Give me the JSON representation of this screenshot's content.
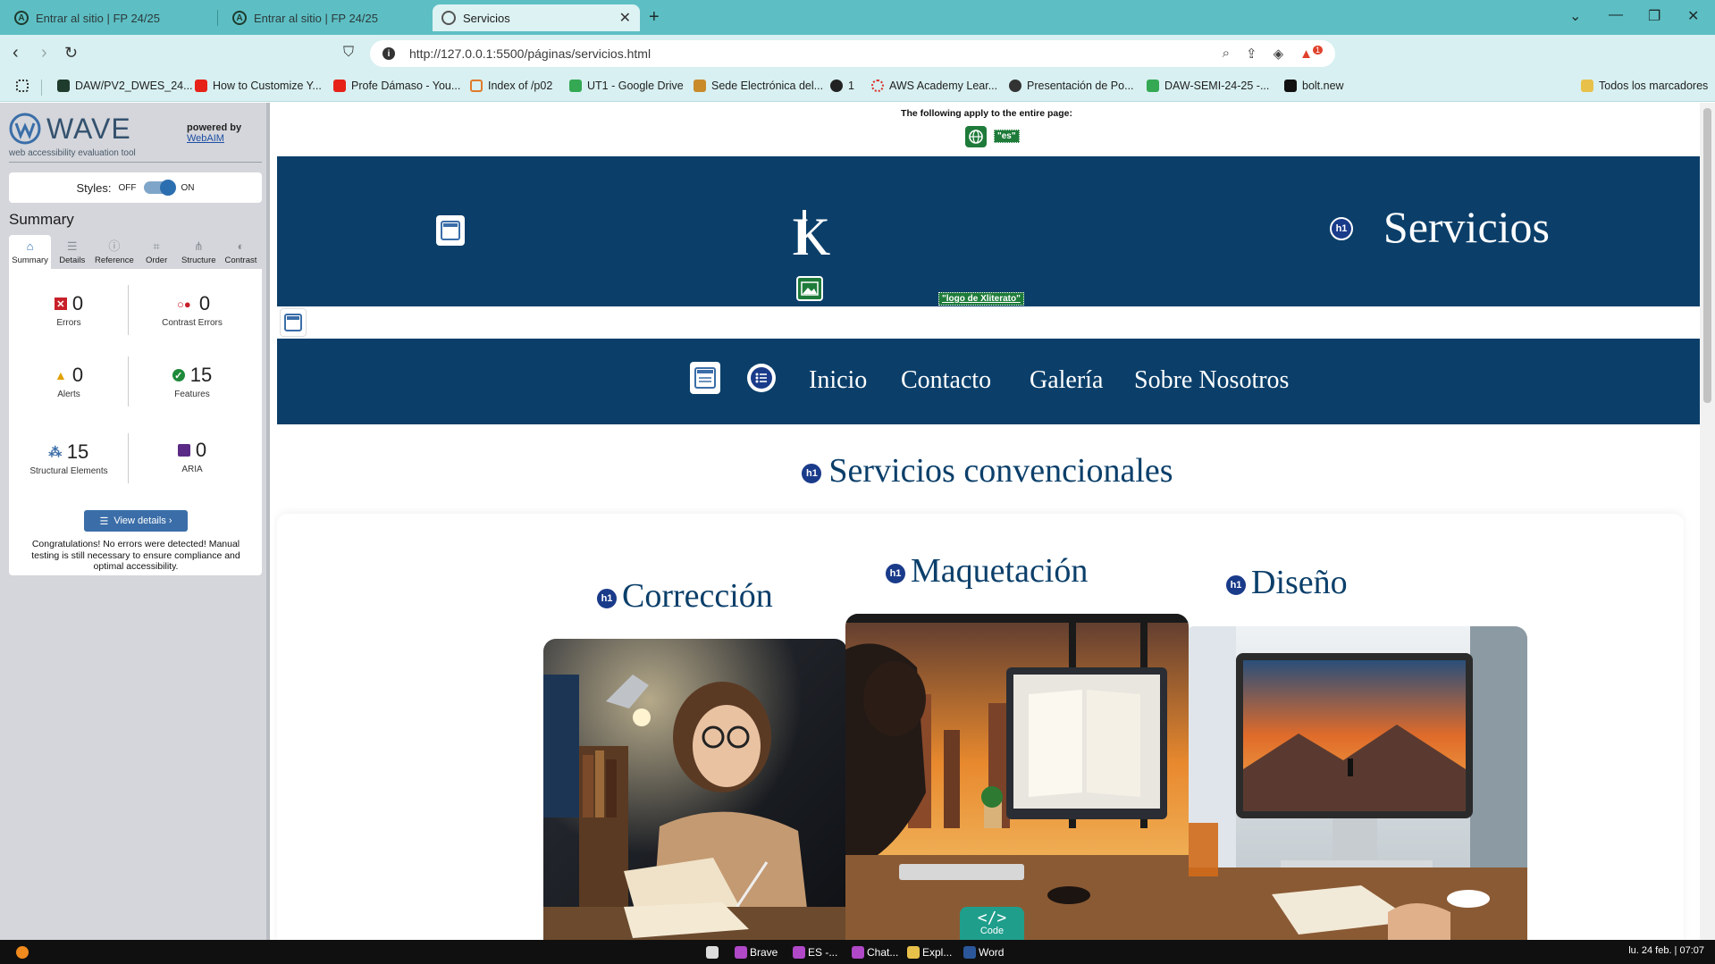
{
  "browser": {
    "tabs": [
      {
        "title": "Entrar al sitio | FP 24/25"
      },
      {
        "title": "Entrar al sitio | FP 24/25"
      },
      {
        "title": "Servicios"
      }
    ],
    "url": "http://127.0.0.1:5500/páginas/servicios.html",
    "brave_badge": "1",
    "bookmarks": [
      {
        "label": "DAW/PV2_DWES_24...",
        "color": "#1e3b2d"
      },
      {
        "label": "How to Customize Y...",
        "color": "#e62117"
      },
      {
        "label": "Profe Dámaso - You...",
        "color": "#e62117"
      },
      {
        "label": "Index of /p02",
        "color": "#e07b2a"
      },
      {
        "label": "UT1 - Google Drive",
        "color": "#34a853"
      },
      {
        "label": "Sede Electrónica del...",
        "color": "#c98a2a"
      },
      {
        "label": "1",
        "color": "#222222"
      },
      {
        "label": "AWS Academy Lear...",
        "color": "#d9302c"
      },
      {
        "label": "Presentación de Po...",
        "color": "#333333"
      },
      {
        "label": "DAW-SEMI-24-25 -...",
        "color": "#34a853"
      },
      {
        "label": "bolt.new",
        "color": "#111111"
      }
    ],
    "all_bookmarks": "Todos los marcadores"
  },
  "wave": {
    "logo": "WAVE",
    "tagline": "web accessibility evaluation tool",
    "powered_by": "powered by",
    "webaim": "WebAIM",
    "styles_label": "Styles:",
    "styles_off": "OFF",
    "styles_on": "ON",
    "summary_heading": "Summary",
    "tabs": [
      {
        "label": "Summary",
        "icon": "home-icon"
      },
      {
        "label": "Details",
        "icon": "list-icon"
      },
      {
        "label": "Reference",
        "icon": "info-icon"
      },
      {
        "label": "Order",
        "icon": "order-icon"
      },
      {
        "label": "Structure",
        "icon": "structure-icon"
      },
      {
        "label": "Contrast",
        "icon": "contrast-icon"
      }
    ],
    "stats": {
      "errors": {
        "value": "0",
        "label": "Errors",
        "color": "#c8202a"
      },
      "contrast_errors": {
        "value": "0",
        "label": "Contrast Errors",
        "color": "#c8202a"
      },
      "alerts": {
        "value": "0",
        "label": "Alerts",
        "color": "#e0a100"
      },
      "features": {
        "value": "15",
        "label": "Features",
        "color": "#1e8a3a"
      },
      "structural": {
        "value": "15",
        "label": "Structural Elements",
        "color": "#3b6ea8"
      },
      "aria": {
        "value": "0",
        "label": "ARIA",
        "color": "#5b2a86"
      }
    },
    "view_details": "View details ›",
    "congrats": "Congratulations! No errors were detected! Manual testing is still necessary to ensure compliance and optimal accessibility."
  },
  "page": {
    "applies": "The following apply to the entire page:",
    "lang_tag": "\"es\"",
    "hero_title": "Servicios",
    "logo_alt": "\"logo de Xliterato\"",
    "nav": [
      "Inicio",
      "Contacto",
      "Galería",
      "Sobre Nosotros"
    ],
    "section_title": "Servicios convencionales",
    "cards": [
      {
        "title": "Corrección"
      },
      {
        "title": "Maquetación"
      },
      {
        "title": "Diseño"
      }
    ],
    "h1_badge": "h1",
    "code_button": "Code"
  },
  "taskbar": {
    "items": [
      "Brave",
      "ES -...",
      "Chat...",
      "Expl...",
      "Word"
    ],
    "clock": "lu. 24 feb. | 07:07"
  },
  "colors": {
    "tabbar": "#5dbfc4",
    "navy": "#0b3f6a",
    "wave_blue": "#3b6ea8",
    "feature_green": "#1e7b3a"
  }
}
